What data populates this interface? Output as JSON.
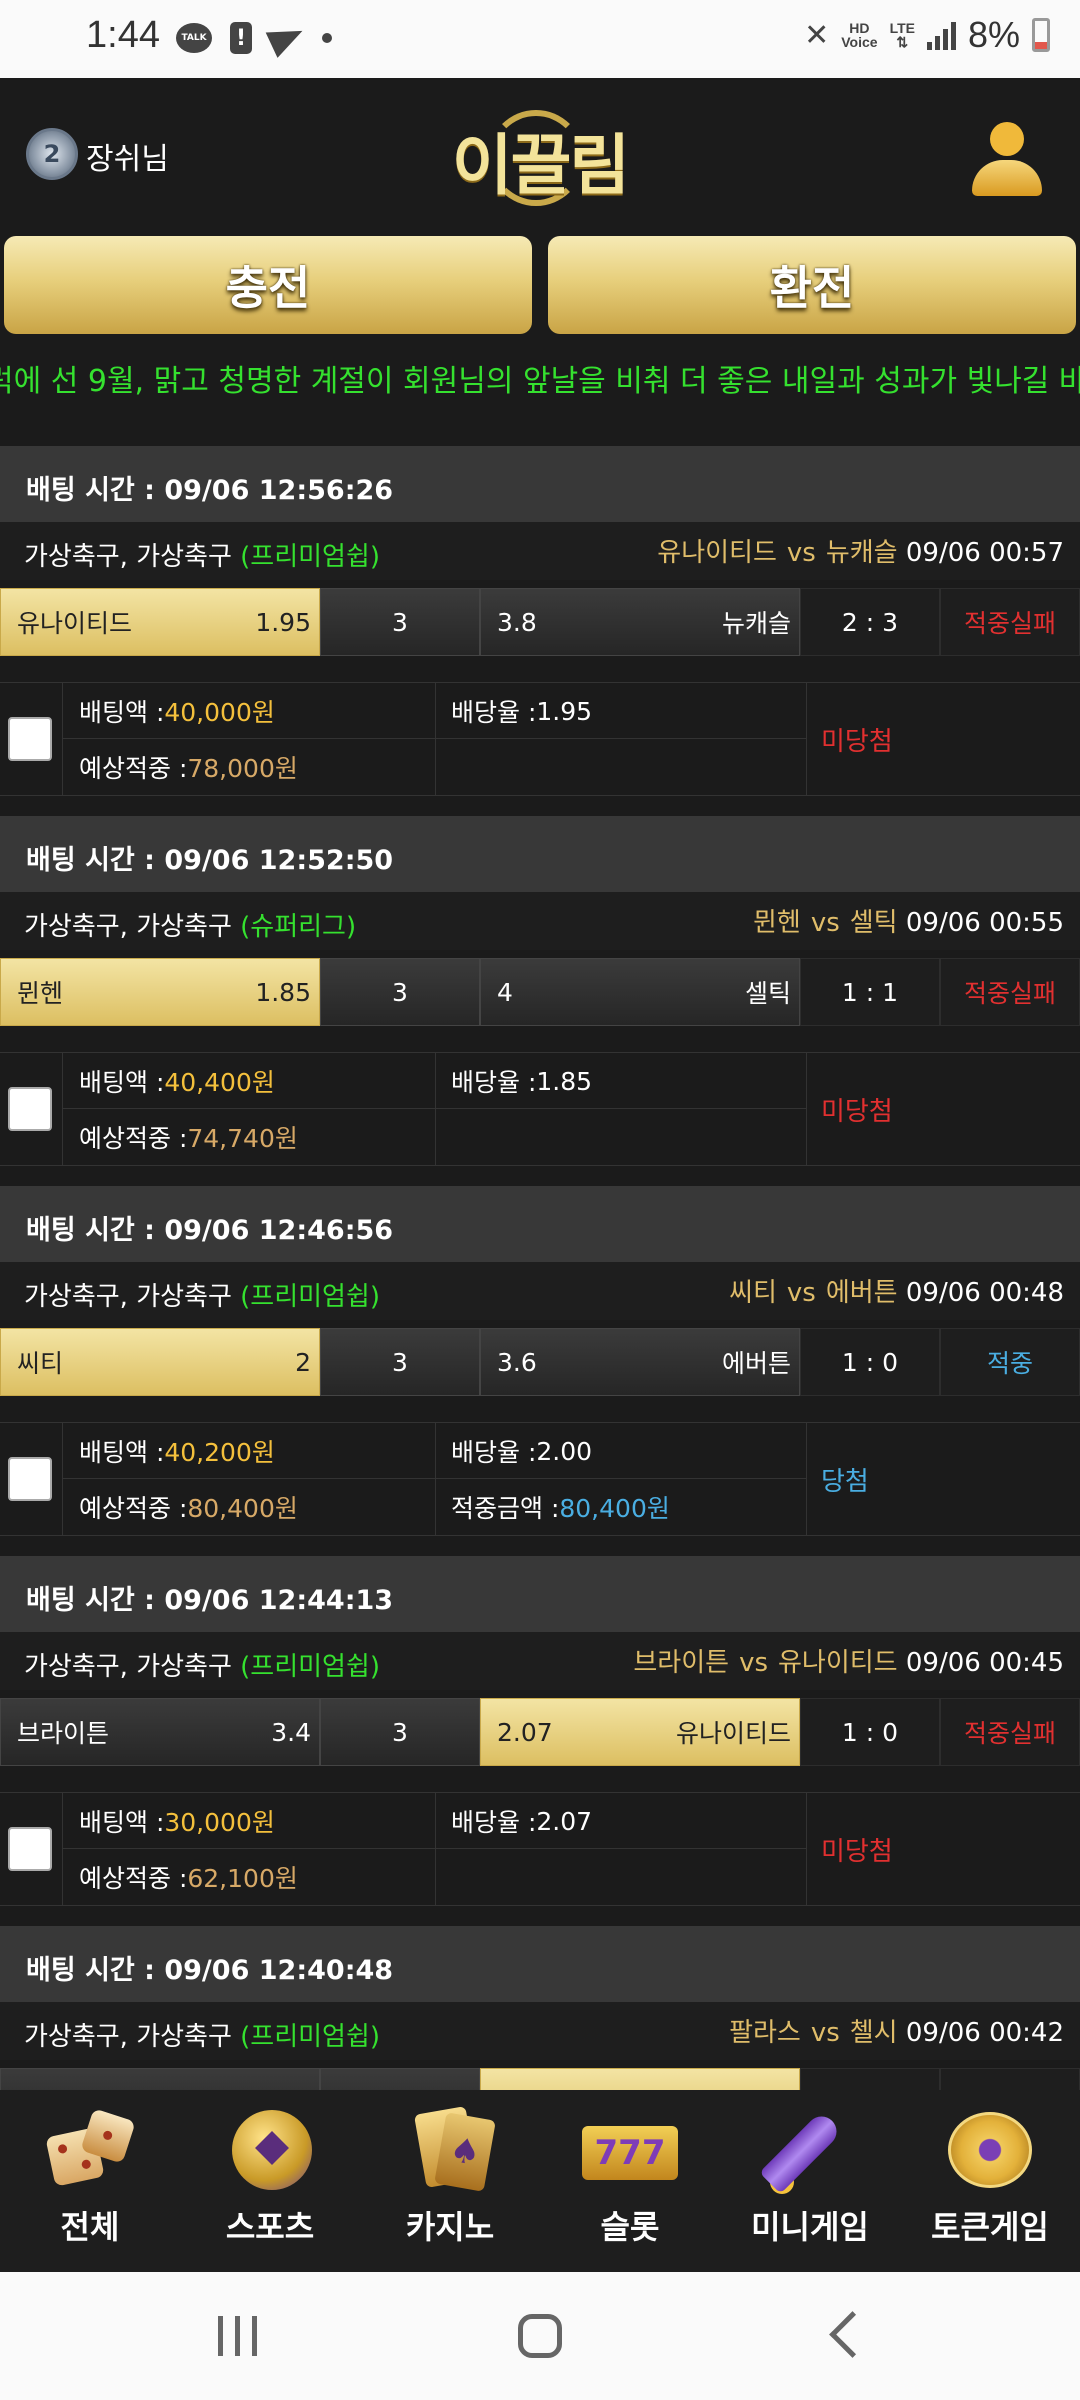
{
  "status_bar": {
    "time": "1:44",
    "talk_label": "TALK",
    "hd_label": "HD",
    "voice_label": "Voice",
    "lte_label": "LTE",
    "battery": "8%"
  },
  "header": {
    "username": "장쉬님",
    "level": "2",
    "logo_text": "이끌림"
  },
  "actions": {
    "charge": "충전",
    "exchange": "환전"
  },
  "marquee": "럭에 선 9월, 맑고 청명한 계절이 회원님의 앞날을 비춰 더 좋은 내일과 성과가 빛나길 바",
  "labels": {
    "bet_amount": "배팅액 : ",
    "expected_win": "예상적중 : ",
    "odds": "배당율 : ",
    "win_amount": "적중금액 : ",
    "vs": "vs"
  },
  "bets": [
    {
      "time": "배팅 시간 : 09/06 12:56:26",
      "league": "가상축구, 가상축구 ",
      "league_tag": "(프리미엄쉽)",
      "home": "유나이티드",
      "away": "뉴캐슬",
      "match_time": "09/06 00:57",
      "home_odds": "1.95",
      "draw_odds": "3",
      "away_odds": "3.8",
      "selected": "home",
      "score": "2 : 3",
      "result": "적중실패",
      "result_color": "red",
      "bet_amount": "40,000원",
      "odds": "1.95",
      "expected": "78,000원",
      "win_amount": "",
      "outcome": "미당첨",
      "outcome_color": "red"
    },
    {
      "time": "배팅 시간 : 09/06 12:52:50",
      "league": "가상축구, 가상축구 ",
      "league_tag": "(슈퍼리그)",
      "home": "뮌헨",
      "away": "셀틱",
      "match_time": "09/06 00:55",
      "home_odds": "1.85",
      "draw_odds": "3",
      "away_odds": "4",
      "selected": "home",
      "score": "1 : 1",
      "result": "적중실패",
      "result_color": "red",
      "bet_amount": "40,400원",
      "odds": "1.85",
      "expected": "74,740원",
      "win_amount": "",
      "outcome": "미당첨",
      "outcome_color": "red"
    },
    {
      "time": "배팅 시간 : 09/06 12:46:56",
      "league": "가상축구, 가상축구 ",
      "league_tag": "(프리미엄쉽)",
      "home": "씨티",
      "away": "에버튼",
      "match_time": "09/06 00:48",
      "home_odds": "2",
      "draw_odds": "3",
      "away_odds": "3.6",
      "selected": "home",
      "score": "1 : 0",
      "result": "적중",
      "result_color": "blue",
      "bet_amount": "40,200원",
      "odds": "2.00",
      "expected": "80,400원",
      "win_amount": "80,400원",
      "outcome": "당첨",
      "outcome_color": "blue"
    },
    {
      "time": "배팅 시간 : 09/06 12:44:13",
      "league": "가상축구, 가상축구 ",
      "league_tag": "(프리미엄쉽)",
      "home": "브라이튼",
      "away": "유나이티드",
      "match_time": "09/06 00:45",
      "home_odds": "3.4",
      "draw_odds": "3",
      "away_odds": "2.07",
      "selected": "away",
      "score": "1 : 0",
      "result": "적중실패",
      "result_color": "red",
      "bet_amount": "30,000원",
      "odds": "2.07",
      "expected": "62,100원",
      "win_amount": "",
      "outcome": "미당첨",
      "outcome_color": "red"
    },
    {
      "time": "배팅 시간 : 09/06 12:40:48",
      "league": "가상축구, 가상축구 ",
      "league_tag": "(프리미엄쉽)",
      "home": "팔라스",
      "away": "첼시",
      "match_time": "09/06 00:42",
      "home_odds": "",
      "draw_odds": "",
      "away_odds": "",
      "selected": "away",
      "score": "",
      "result": "",
      "result_color": "red",
      "bet_amount": "",
      "odds": "",
      "expected": "",
      "win_amount": "",
      "outcome": "",
      "outcome_color": "red"
    }
  ],
  "bottom_nav": [
    {
      "label": "전체",
      "icon": "dice-icon"
    },
    {
      "label": "스포츠",
      "icon": "soccer-ball-icon"
    },
    {
      "label": "카지노",
      "icon": "playing-cards-icon"
    },
    {
      "label": "슬롯",
      "icon": "slot-777-icon"
    },
    {
      "label": "미니게임",
      "icon": "rocket-icon"
    },
    {
      "label": "토큰게임",
      "icon": "roulette-icon"
    }
  ],
  "slot_text": "777",
  "colors": {
    "accent_gold": "#dcbf62",
    "green": "#35e12f",
    "red": "#e23030",
    "blue": "#4aaee2",
    "amount_gold": "#f4c03c"
  }
}
